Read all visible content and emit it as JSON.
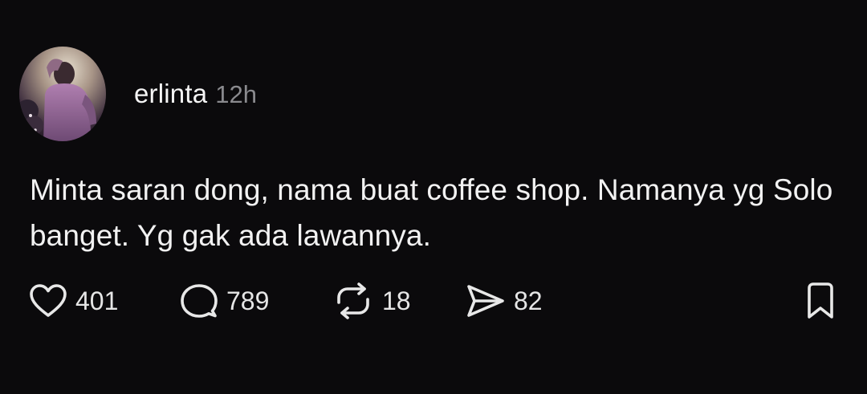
{
  "post": {
    "username": "erlinta",
    "time": "12h",
    "text": "Minta saran dong, nama buat coffee shop. Namanya yg Solo banget. Yg gak ada lawannya."
  },
  "actions": {
    "likes": "401",
    "replies": "789",
    "reposts": "18",
    "shares": "82"
  },
  "icons": {
    "like": "heart-icon",
    "reply": "speech-bubble-icon",
    "repost": "repost-arrows-icon",
    "share": "send-arrow-icon",
    "save": "bookmark-icon"
  },
  "colors": {
    "background": "#0b0a0c",
    "text": "#f2f2f2",
    "muted": "#8a8a8e"
  }
}
